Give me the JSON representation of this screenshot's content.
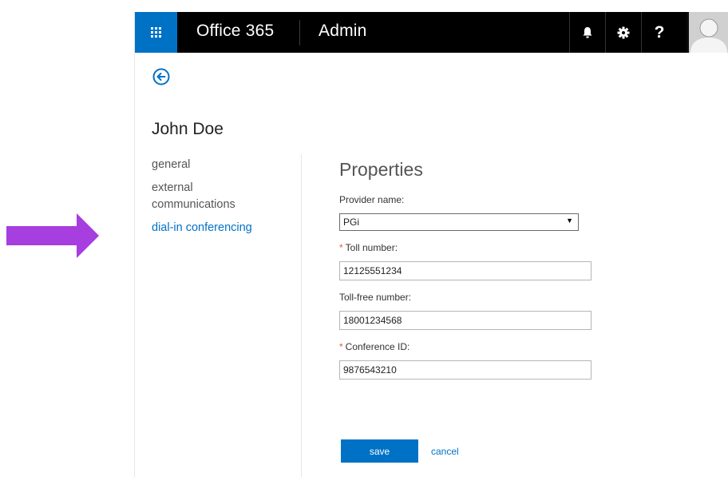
{
  "colors": {
    "accent": "#0072c6",
    "topbar": "#000000",
    "callout_arrow": "#a63ee0",
    "required_marker": "#e8553a"
  },
  "header": {
    "app_title": "Office 365",
    "section_title": "Admin",
    "icons": [
      "waffle-icon",
      "bell-icon",
      "gear-icon",
      "help-icon",
      "user-avatar-icon"
    ],
    "help_label": "?"
  },
  "page": {
    "user_name": "John Doe"
  },
  "nav": {
    "items": [
      {
        "label": "general",
        "active": false
      },
      {
        "label": "external communications",
        "active": false
      },
      {
        "label": "dial-in conferencing",
        "active": true
      }
    ]
  },
  "form": {
    "heading": "Properties",
    "provider": {
      "label": "Provider name:",
      "value": "PGi"
    },
    "toll": {
      "required_mark": "*",
      "label": "Toll number:",
      "value": "12125551234"
    },
    "toll_free": {
      "label": "Toll-free number:",
      "value": "18001234568"
    },
    "conference_id": {
      "required_mark": "*",
      "label": "Conference ID:",
      "value": "9876543210"
    }
  },
  "actions": {
    "save_label": "save",
    "cancel_label": "cancel"
  }
}
